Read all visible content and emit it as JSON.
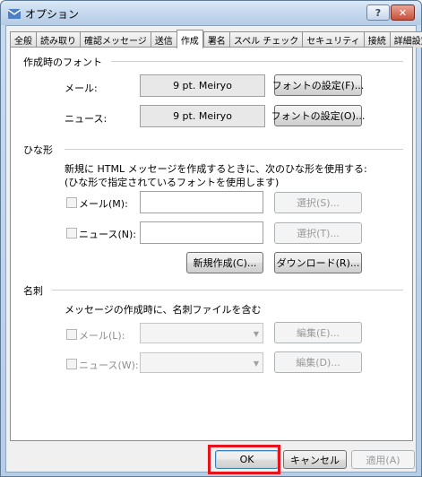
{
  "window": {
    "title": "オプション",
    "help": "?",
    "close": "✕"
  },
  "tabs": [
    "全般",
    "読み取り",
    "確認メッセージ",
    "送信",
    "作成",
    "署名",
    "スペル チェック",
    "セキュリティ",
    "接続",
    "詳細設定"
  ],
  "compose_font": {
    "heading": "作成時のフォント",
    "mail_label": "メール:",
    "mail_font": "9 pt. Meiryo",
    "mail_button": "フォントの設定(F)...",
    "news_label": "ニュース:",
    "news_font": "9 pt. Meiryo",
    "news_button": "フォントの設定(O)..."
  },
  "stationery": {
    "heading": "ひな形",
    "desc1": "新規に HTML メッセージを作成するときに、次のひな形を使用する:",
    "desc2": "(ひな形で指定されているフォントを使用します)",
    "mail_label": "メール(M):",
    "mail_select": "選択(S)...",
    "news_label": "ニュース(N):",
    "news_select": "選択(T)...",
    "new_button": "新規作成(C)...",
    "download_button": "ダウンロード(R)..."
  },
  "business_card": {
    "heading": "名刺",
    "desc": "メッセージの作成時に、名刺ファイルを含む",
    "mail_label": "メール(L):",
    "mail_edit": "編集(E)...",
    "news_label": "ニュース(W):",
    "news_edit": "編集(D)..."
  },
  "footer": {
    "ok": "OK",
    "cancel": "キャンセル",
    "apply": "適用(A)"
  },
  "colors": {
    "highlight": "#e8121a"
  }
}
